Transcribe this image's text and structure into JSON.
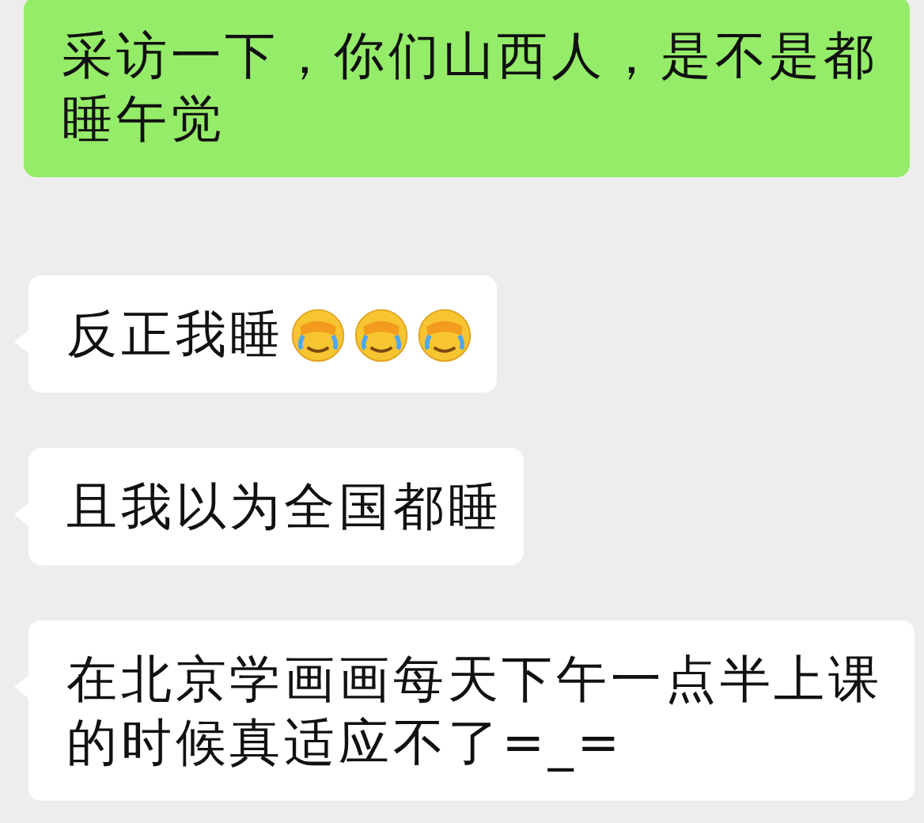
{
  "messages": [
    {
      "kind": "sent",
      "text": "采访一下，你们山西人，是不是都睡午觉"
    },
    {
      "kind": "received",
      "text": "反正我睡",
      "emojis": [
        {
          "kind": "facepalm"
        },
        {
          "kind": "facepalm"
        },
        {
          "kind": "facepalm"
        }
      ]
    },
    {
      "kind": "received",
      "text": "且我以为全国都睡"
    },
    {
      "kind": "received",
      "text": "在北京学画画每天下午一点半上课的时候真适应不了=_="
    }
  ]
}
